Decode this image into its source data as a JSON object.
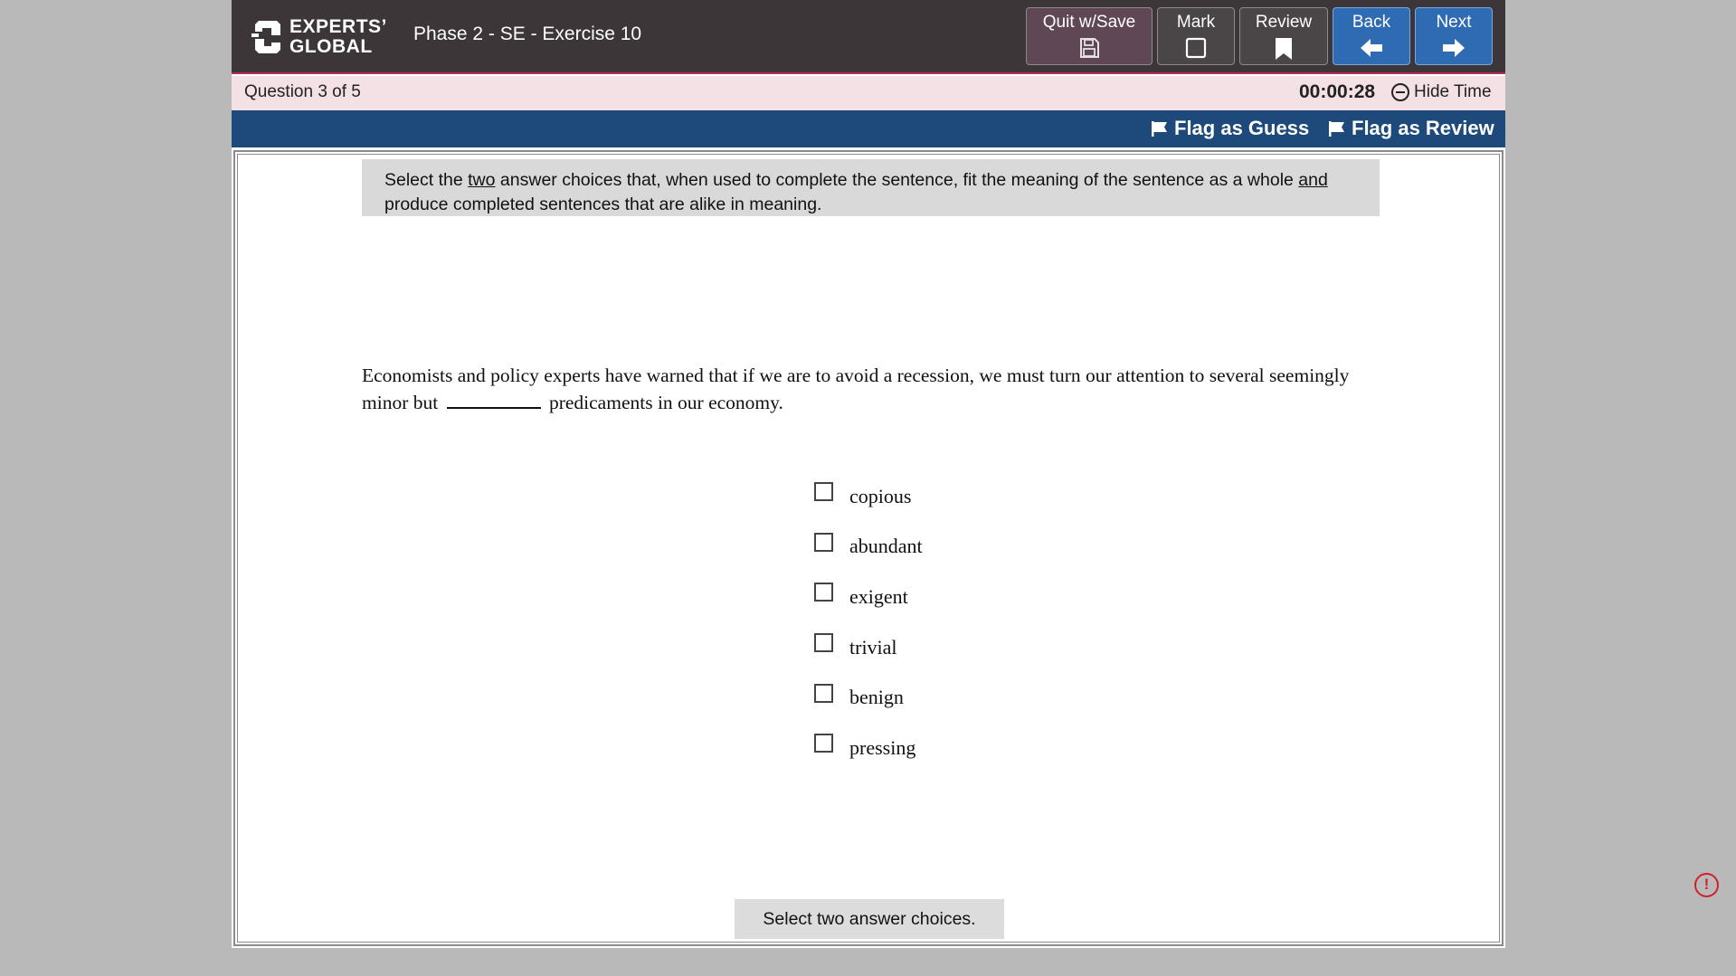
{
  "header": {
    "logo_line1": "EXPERTS’",
    "logo_line2": "GLOBAL",
    "exercise_title": "Phase 2 - SE - Exercise 10",
    "buttons": {
      "quit": "Quit w/Save",
      "mark": "Mark",
      "review": "Review",
      "back": "Back",
      "next": "Next"
    }
  },
  "question_bar": {
    "count": "Question 3 of 5",
    "timer": "00:00:28",
    "hide_time": "Hide Time"
  },
  "flags": {
    "guess": "Flag as Guess",
    "review": "Flag as Review"
  },
  "instruction": {
    "part1": "Select the ",
    "two": "two",
    "part2": " answer choices that, when used to complete the sentence, fit the meaning of the sentence as a whole ",
    "and": "and",
    "part3": " produce completed sentences that are alike in meaning."
  },
  "sentence": {
    "before_blank": "Economists and policy experts have warned that if we are to avoid a recession, we must turn our attention to several seemingly minor but",
    "after_blank": "predicaments in our economy."
  },
  "choices": [
    "copious",
    "abundant",
    "exigent",
    "trivial",
    "benign",
    "pressing"
  ],
  "status_message": "Select two answer choices.",
  "alert_symbol": "!"
}
